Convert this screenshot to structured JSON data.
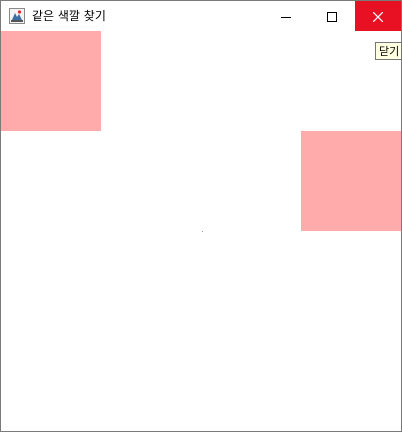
{
  "window": {
    "title": "같은 색깔 찾기",
    "icon": "java-app-icon",
    "controls": {
      "minimize_icon": "minimize-icon",
      "maximize_icon": "maximize-icon",
      "close_icon": "close-icon",
      "close_hover_color": "#e81123"
    }
  },
  "tooltip": {
    "text": "닫기"
  },
  "board": {
    "background": "#ffffff",
    "block_color": "#ffaaab",
    "blocks": [
      {
        "id": "block-top-left"
      },
      {
        "id": "block-right-middle"
      }
    ]
  }
}
